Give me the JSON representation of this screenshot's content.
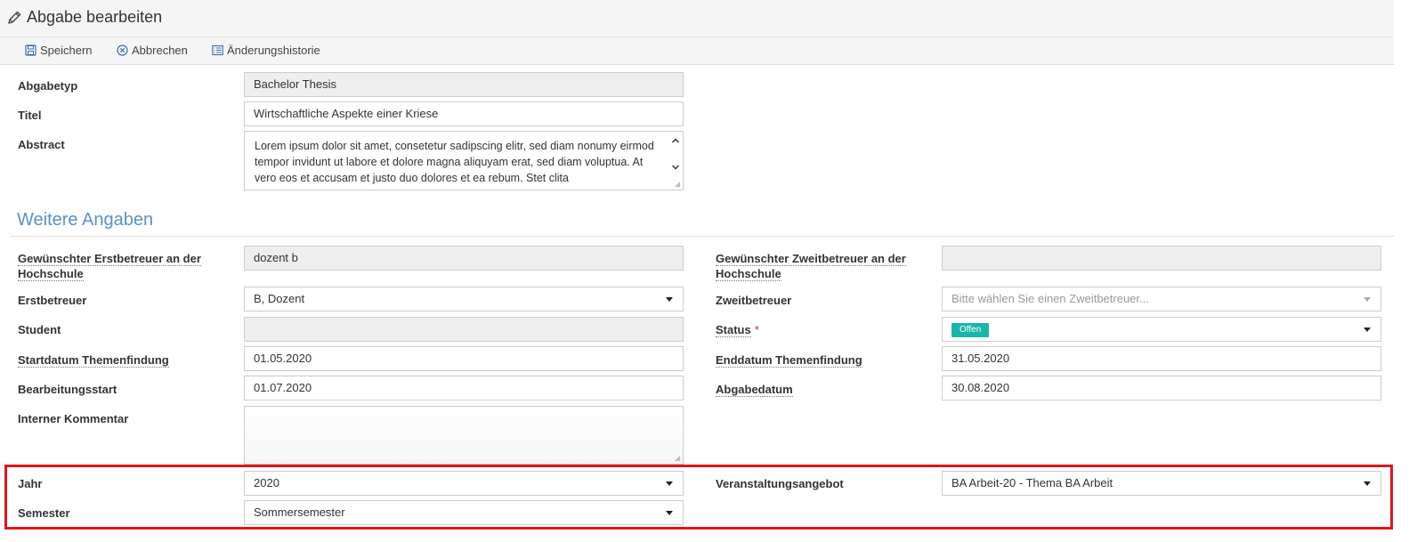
{
  "header": {
    "title": "Abgabe bearbeiten",
    "icon": "pencil-icon"
  },
  "toolbar": {
    "save": "Speichern",
    "cancel": "Abbrechen",
    "history": "Änderungshistorie"
  },
  "form": {
    "abgabetyp": {
      "label": "Abgabetyp",
      "value": "Bachelor Thesis"
    },
    "titel": {
      "label": "Titel",
      "value": "Wirtschaftliche Aspekte einer Kriese"
    },
    "abstract": {
      "label": "Abstract",
      "value": "Lorem ipsum dolor sit amet, consetetur sadipscing elitr, sed diam nonumy eirmod tempor invidunt ut labore et dolore magna aliquyam erat, sed diam voluptua. At vero eos et accusam et justo duo dolores et ea rebum. Stet clita"
    }
  },
  "section": {
    "title": "Weitere Angaben"
  },
  "details": {
    "erstbetreuer_wunsch": {
      "label": "Gewünschter Erstbetreuer an der Hochschule",
      "value": "dozent b"
    },
    "zweitbetreuer_wunsch": {
      "label": "Gewünschter Zweitbetreuer an der Hochschule",
      "value": ""
    },
    "erstbetreuer": {
      "label": "Erstbetreuer",
      "value": "B, Dozent"
    },
    "zweitbetreuer": {
      "label": "Zweitbetreuer",
      "placeholder": "Bitte wählen Sie einen Zweitbetreuer..."
    },
    "student": {
      "label": "Student",
      "value": ""
    },
    "status": {
      "label": "Status",
      "required": "*",
      "value": "Offen",
      "badge_color": "#1ab5a8"
    },
    "startdatum": {
      "label": "Startdatum Themenfindung",
      "value": "01.05.2020"
    },
    "enddatum": {
      "label": "Enddatum Themenfindung",
      "value": "31.05.2020"
    },
    "bearbeitungsstart": {
      "label": "Bearbeitungsstart",
      "value": "01.07.2020"
    },
    "abgabedatum": {
      "label": "Abgabedatum",
      "value": "30.08.2020"
    },
    "kommentar": {
      "label": "Interner Kommentar",
      "value": ""
    },
    "jahr": {
      "label": "Jahr",
      "value": "2020"
    },
    "veranstaltung": {
      "label": "Veranstaltungsangebot",
      "value": "BA Arbeit-20 - Thema BA Arbeit"
    },
    "semester": {
      "label": "Semester",
      "value": "Sommersemester"
    }
  },
  "colors": {
    "accent": "#5b8fc7",
    "highlight": "#e2141c",
    "status": "#1ab5a8"
  }
}
